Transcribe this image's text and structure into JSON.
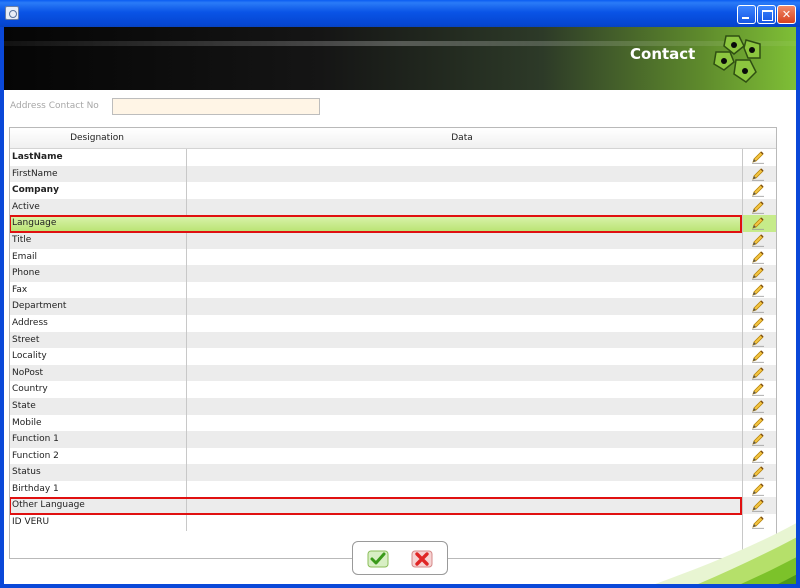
{
  "window": {
    "title": ""
  },
  "header": {
    "title": "Contact"
  },
  "address": {
    "label": "Address Contact No",
    "value": ""
  },
  "grid": {
    "columns": [
      "Designation",
      "Data"
    ],
    "rows": [
      {
        "label": "LastName",
        "bold": true
      },
      {
        "label": "FirstName"
      },
      {
        "label": "Company",
        "bold": true
      },
      {
        "label": "Active"
      },
      {
        "label": "Language",
        "selected": true,
        "highlighted": true
      },
      {
        "label": "Title"
      },
      {
        "label": "Email"
      },
      {
        "label": "Phone"
      },
      {
        "label": "Fax"
      },
      {
        "label": "Department"
      },
      {
        "label": "Address"
      },
      {
        "label": "Street"
      },
      {
        "label": "Locality"
      },
      {
        "label": "NoPost"
      },
      {
        "label": "Country"
      },
      {
        "label": "State"
      },
      {
        "label": "Mobile"
      },
      {
        "label": "Function 1"
      },
      {
        "label": "Function 2"
      },
      {
        "label": "Status"
      },
      {
        "label": "Birthday 1"
      },
      {
        "label": "Other Language",
        "highlighted": true
      },
      {
        "label": "ID VERU"
      }
    ]
  },
  "actions": {
    "ok_icon": "check-icon",
    "cancel_icon": "cross-icon"
  },
  "colors": {
    "selection": "#c6eb8a",
    "highlight_border": "#e01010",
    "banner_accent": "#7fbf36"
  }
}
